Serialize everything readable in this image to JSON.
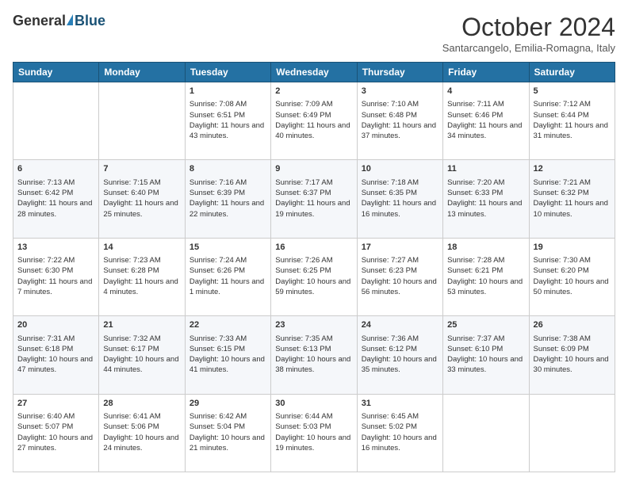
{
  "logo": {
    "general": "General",
    "blue": "Blue"
  },
  "title": "October 2024",
  "subtitle": "Santarcangelo, Emilia-Romagna, Italy",
  "days": [
    "Sunday",
    "Monday",
    "Tuesday",
    "Wednesday",
    "Thursday",
    "Friday",
    "Saturday"
  ],
  "weeks": [
    [
      {
        "day": "",
        "content": ""
      },
      {
        "day": "",
        "content": ""
      },
      {
        "day": "1",
        "content": "Sunrise: 7:08 AM\nSunset: 6:51 PM\nDaylight: 11 hours and 43 minutes."
      },
      {
        "day": "2",
        "content": "Sunrise: 7:09 AM\nSunset: 6:49 PM\nDaylight: 11 hours and 40 minutes."
      },
      {
        "day": "3",
        "content": "Sunrise: 7:10 AM\nSunset: 6:48 PM\nDaylight: 11 hours and 37 minutes."
      },
      {
        "day": "4",
        "content": "Sunrise: 7:11 AM\nSunset: 6:46 PM\nDaylight: 11 hours and 34 minutes."
      },
      {
        "day": "5",
        "content": "Sunrise: 7:12 AM\nSunset: 6:44 PM\nDaylight: 11 hours and 31 minutes."
      }
    ],
    [
      {
        "day": "6",
        "content": "Sunrise: 7:13 AM\nSunset: 6:42 PM\nDaylight: 11 hours and 28 minutes."
      },
      {
        "day": "7",
        "content": "Sunrise: 7:15 AM\nSunset: 6:40 PM\nDaylight: 11 hours and 25 minutes."
      },
      {
        "day": "8",
        "content": "Sunrise: 7:16 AM\nSunset: 6:39 PM\nDaylight: 11 hours and 22 minutes."
      },
      {
        "day": "9",
        "content": "Sunrise: 7:17 AM\nSunset: 6:37 PM\nDaylight: 11 hours and 19 minutes."
      },
      {
        "day": "10",
        "content": "Sunrise: 7:18 AM\nSunset: 6:35 PM\nDaylight: 11 hours and 16 minutes."
      },
      {
        "day": "11",
        "content": "Sunrise: 7:20 AM\nSunset: 6:33 PM\nDaylight: 11 hours and 13 minutes."
      },
      {
        "day": "12",
        "content": "Sunrise: 7:21 AM\nSunset: 6:32 PM\nDaylight: 11 hours and 10 minutes."
      }
    ],
    [
      {
        "day": "13",
        "content": "Sunrise: 7:22 AM\nSunset: 6:30 PM\nDaylight: 11 hours and 7 minutes."
      },
      {
        "day": "14",
        "content": "Sunrise: 7:23 AM\nSunset: 6:28 PM\nDaylight: 11 hours and 4 minutes."
      },
      {
        "day": "15",
        "content": "Sunrise: 7:24 AM\nSunset: 6:26 PM\nDaylight: 11 hours and 1 minute."
      },
      {
        "day": "16",
        "content": "Sunrise: 7:26 AM\nSunset: 6:25 PM\nDaylight: 10 hours and 59 minutes."
      },
      {
        "day": "17",
        "content": "Sunrise: 7:27 AM\nSunset: 6:23 PM\nDaylight: 10 hours and 56 minutes."
      },
      {
        "day": "18",
        "content": "Sunrise: 7:28 AM\nSunset: 6:21 PM\nDaylight: 10 hours and 53 minutes."
      },
      {
        "day": "19",
        "content": "Sunrise: 7:30 AM\nSunset: 6:20 PM\nDaylight: 10 hours and 50 minutes."
      }
    ],
    [
      {
        "day": "20",
        "content": "Sunrise: 7:31 AM\nSunset: 6:18 PM\nDaylight: 10 hours and 47 minutes."
      },
      {
        "day": "21",
        "content": "Sunrise: 7:32 AM\nSunset: 6:17 PM\nDaylight: 10 hours and 44 minutes."
      },
      {
        "day": "22",
        "content": "Sunrise: 7:33 AM\nSunset: 6:15 PM\nDaylight: 10 hours and 41 minutes."
      },
      {
        "day": "23",
        "content": "Sunrise: 7:35 AM\nSunset: 6:13 PM\nDaylight: 10 hours and 38 minutes."
      },
      {
        "day": "24",
        "content": "Sunrise: 7:36 AM\nSunset: 6:12 PM\nDaylight: 10 hours and 35 minutes."
      },
      {
        "day": "25",
        "content": "Sunrise: 7:37 AM\nSunset: 6:10 PM\nDaylight: 10 hours and 33 minutes."
      },
      {
        "day": "26",
        "content": "Sunrise: 7:38 AM\nSunset: 6:09 PM\nDaylight: 10 hours and 30 minutes."
      }
    ],
    [
      {
        "day": "27",
        "content": "Sunrise: 6:40 AM\nSunset: 5:07 PM\nDaylight: 10 hours and 27 minutes."
      },
      {
        "day": "28",
        "content": "Sunrise: 6:41 AM\nSunset: 5:06 PM\nDaylight: 10 hours and 24 minutes."
      },
      {
        "day": "29",
        "content": "Sunrise: 6:42 AM\nSunset: 5:04 PM\nDaylight: 10 hours and 21 minutes."
      },
      {
        "day": "30",
        "content": "Sunrise: 6:44 AM\nSunset: 5:03 PM\nDaylight: 10 hours and 19 minutes."
      },
      {
        "day": "31",
        "content": "Sunrise: 6:45 AM\nSunset: 5:02 PM\nDaylight: 10 hours and 16 minutes."
      },
      {
        "day": "",
        "content": ""
      },
      {
        "day": "",
        "content": ""
      }
    ]
  ]
}
